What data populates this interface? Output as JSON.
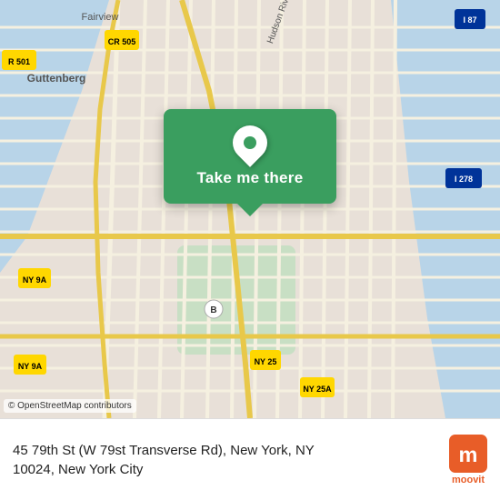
{
  "map": {
    "attribution": "© OpenStreetMap contributors"
  },
  "popup": {
    "button_label": "Take me there"
  },
  "bottom_bar": {
    "address_line1": "45 79th St (W 79st Transverse Rd), New York, NY",
    "address_line2": "10024, New York City"
  },
  "moovit": {
    "label": "moovit"
  },
  "colors": {
    "green": "#3a9e5f",
    "orange": "#e85d28"
  }
}
